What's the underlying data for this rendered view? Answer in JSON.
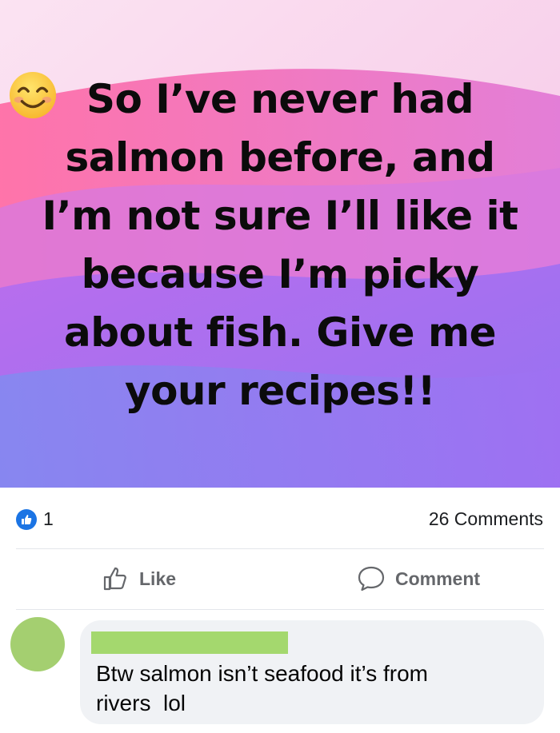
{
  "post": {
    "text_lines": [
      "So I’ve never had",
      "salmon before, and",
      "I’m not sure I’ll like it",
      "because I’m picky",
      "about fish. Give me",
      "your recipes!!"
    ],
    "emoji": "smiling-face-emoji",
    "colors": {
      "bg_pink": "#ee72b6",
      "bg_purple": "#9a6ef0",
      "bg_light": "#f4a6d7"
    }
  },
  "stats": {
    "like_count": "1",
    "comments_label": "26 Comments"
  },
  "actions": {
    "like_label": "Like",
    "comment_label": "Comment"
  },
  "comment": {
    "text_lines": [
      "Btw salmon isn’t seafood it’s from",
      "rivers  lol"
    ]
  },
  "colors": {
    "facebook_blue": "#1b74e4",
    "redaction_green": "#a4d86e",
    "bubble_bg": "#f0f2f5"
  }
}
